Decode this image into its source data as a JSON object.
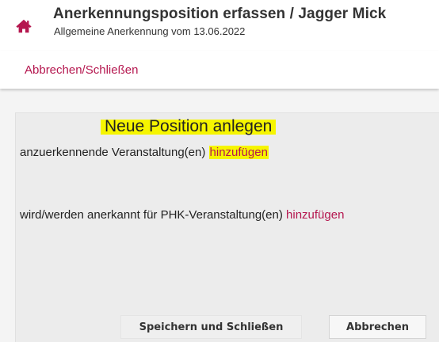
{
  "header": {
    "title": "Anerkennungsposition erfassen  / Jagger Mick",
    "subtitle": "Allgemeine Anerkennung vom 13.06.2022",
    "home_icon": "home-icon",
    "accent_color": "#b5174f"
  },
  "actionbar": {
    "cancel_close_label": "Abbrechen/Schließen"
  },
  "dialog": {
    "title": "Neue Position anlegen",
    "source_row": {
      "label": "anzuerkennende Veranstaltung(en)",
      "add_label": "hinzufügen"
    },
    "target_row": {
      "label": "wird/werden anerkannt für PHK-Veranstaltung(en)",
      "add_label": "hinzufügen"
    },
    "save_button": "Speichern und Schließen",
    "cancel_button": "Abbrechen",
    "highlight_color": "#f6f500"
  }
}
